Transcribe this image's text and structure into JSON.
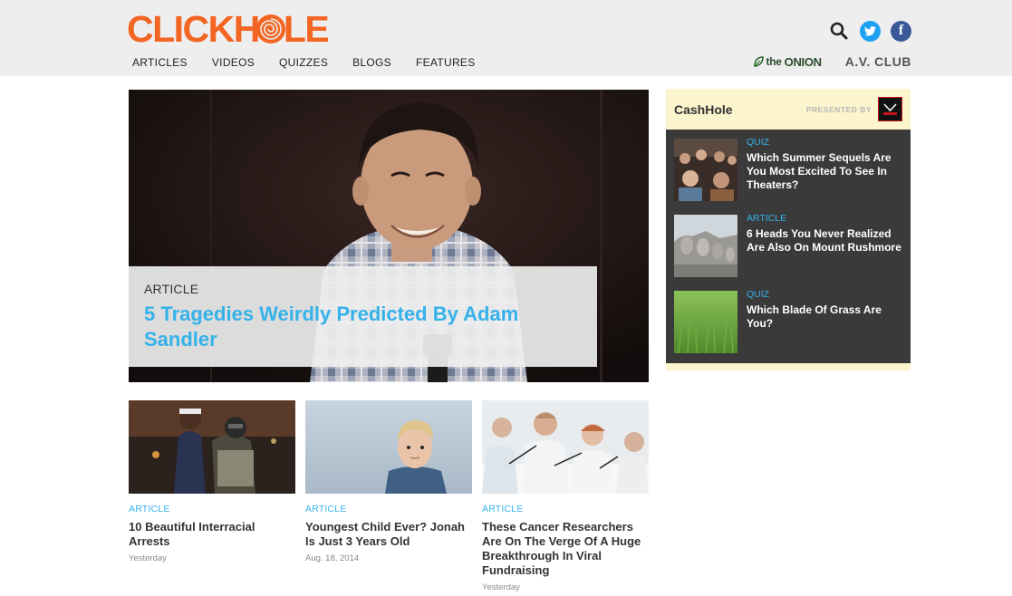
{
  "header": {
    "logo_text": "CLICKHOLE",
    "nav": [
      "ARTICLES",
      "VIDEOS",
      "QUIZZES",
      "BLOGS",
      "FEATURES"
    ],
    "partners": {
      "onion_the": "the",
      "onion": "ONION",
      "avclub": "A.V. CLUB"
    }
  },
  "hero": {
    "type": "ARTICLE",
    "title": "5 Tragedies Weirdly Predicted By Adam Sandler"
  },
  "cards": [
    {
      "type": "ARTICLE",
      "title": "10 Beautiful Interracial Arrests",
      "date": "Yesterday"
    },
    {
      "type": "ARTICLE",
      "title": "Youngest Child Ever? Jonah Is Just 3 Years Old",
      "date": "Aug. 18, 2014"
    },
    {
      "type": "ARTICLE",
      "title": "These Cancer Researchers Are On The Verge Of A Huge Breakthrough In Viral Fundraising",
      "date": "Yesterday"
    }
  ],
  "sidebar": {
    "title": "CashHole",
    "presented": "PRESENTED BY",
    "items": [
      {
        "type": "QUIZ",
        "title": "Which Summer Sequels Are You Most Excited To See In Theaters?"
      },
      {
        "type": "ARTICLE",
        "title": "6 Heads You Never Realized Are Also On Mount Rushmore"
      },
      {
        "type": "QUIZ",
        "title": "Which Blade Of Grass Are You?"
      }
    ]
  },
  "colors": {
    "brand_orange": "#f26522",
    "accent_blue": "#35b2e9",
    "header_bg": "#efeeef",
    "sidebar_yellow": "#fbf4cd",
    "sidebar_dark": "#3a3a3a"
  },
  "icons": [
    "search-icon",
    "twitter-icon",
    "facebook-icon",
    "onion-leaf-icon",
    "clickhole-swirl-icon"
  ]
}
